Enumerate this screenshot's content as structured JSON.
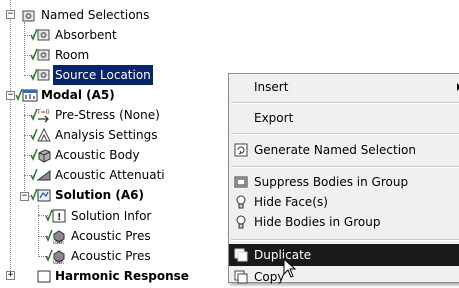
{
  "tree": {
    "items": [
      {
        "label": "Named Selections",
        "icon": "named-selection-group-icon",
        "expanded": true
      },
      {
        "label": "Absorbent",
        "icon": "named-selection-icon"
      },
      {
        "label": "Room",
        "icon": "named-selection-icon"
      },
      {
        "label": "Source Location",
        "icon": "named-selection-icon",
        "selected": true
      },
      {
        "label": "Modal (A5)",
        "icon": "modal-analysis-icon",
        "bold": true,
        "expanded": true
      },
      {
        "label": "Pre-Stress (None)",
        "icon": "pre-stress-icon"
      },
      {
        "label": "Analysis Settings",
        "icon": "analysis-settings-icon"
      },
      {
        "label": "Acoustic Body",
        "icon": "acoustic-body-icon"
      },
      {
        "label": "Acoustic Attenuati",
        "icon": "acoustic-attenuation-icon"
      },
      {
        "label": "Solution (A6)",
        "icon": "solution-icon",
        "bold": true,
        "expanded": true
      },
      {
        "label": "Solution Infor",
        "icon": "solution-info-icon"
      },
      {
        "label": "Acoustic Pres",
        "icon": "user-result-icon"
      },
      {
        "label": "Acoustic Pres",
        "icon": "user-result-icon"
      },
      {
        "label": "Harmonic Response",
        "icon": "harmonic-response-icon",
        "bold": true
      }
    ]
  },
  "context_menu": {
    "items": [
      {
        "label": "Insert",
        "has_submenu": true
      },
      {
        "label": "Export"
      },
      {
        "label": "Generate Named Selection",
        "icon": "generate-named-selection-icon"
      },
      {
        "label": "Suppress Bodies in Group",
        "icon": "suppress-icon"
      },
      {
        "label": "Hide Face(s)",
        "icon": "bulb-icon"
      },
      {
        "label": "Hide Bodies in Group",
        "icon": "bulb-icon"
      },
      {
        "label": "Duplicate",
        "icon": "duplicate-icon",
        "highlighted": true
      },
      {
        "label": "Copy",
        "icon": "copy-icon"
      }
    ]
  },
  "colors": {
    "selection": "#0a246a",
    "menu_highlight": "#1a1a1a",
    "menu_bg": "#f0f0f0"
  }
}
